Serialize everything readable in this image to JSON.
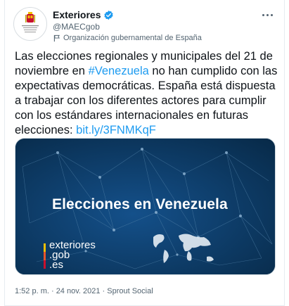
{
  "account": {
    "display_name": "Exteriores",
    "handle": "@MAECgob",
    "label": "Organización gubernamental de España",
    "verified": true,
    "avatar_logo_text": "GOBIERNO DE ESPAÑA MINISTERIO DE ASUNTOS EXTERIORES"
  },
  "tweet": {
    "text_before_hashtag": "Las elecciones regionales y municipales del 21 de noviembre en ",
    "hashtag": "#Venezuela",
    "text_after_hashtag": " no han cumplido con las expectativas democráticas. España está dispuesta a trabajar con los diferentes actores para cumplir con los estándares internacionales en futuras elecciones: ",
    "link": "bit.ly/3FNMKqF"
  },
  "media": {
    "title": "Elecciones en Venezuela",
    "logo_lines": [
      "exteriores",
      ".gob",
      ".es"
    ]
  },
  "meta": {
    "timestamp": "1:52 p. m. · 24 nov. 2021 · Sprout Social"
  },
  "colors": {
    "link": "#1d9bf0",
    "verified": "#1d9bf0",
    "media_bg": "#0a3258",
    "text_secondary": "#536471"
  },
  "icons": {
    "verified": "verified-badge-icon",
    "label": "government-flag-icon",
    "more": "more-options-icon"
  }
}
